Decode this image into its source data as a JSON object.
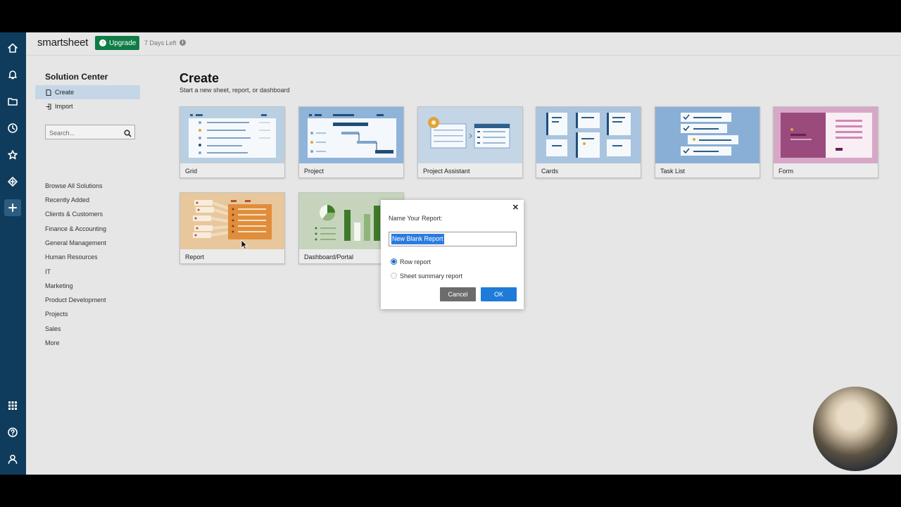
{
  "app": {
    "logo": "smartsheet",
    "upgrade_label": "Upgrade",
    "trial_text": "7 Days Left"
  },
  "leftnav": {
    "top_icons": [
      "home-icon",
      "bell-icon",
      "folder-icon",
      "clock-icon",
      "star-icon",
      "solutions-icon",
      "plus-icon"
    ],
    "bottom_icons": [
      "apps-grid-icon",
      "help-icon",
      "user-icon"
    ]
  },
  "sidebar": {
    "title": "Solution Center",
    "create_label": "Create",
    "import_label": "Import",
    "search_placeholder": "Search...",
    "categories": [
      "Browse All Solutions",
      "Recently Added",
      "Clients & Customers",
      "Finance & Accounting",
      "General Management",
      "Human Resources",
      "IT",
      "Marketing",
      "Product Development",
      "Projects",
      "Sales",
      "More"
    ]
  },
  "main": {
    "title": "Create",
    "subtitle": "Start a new sheet, report, or dashboard",
    "cards": [
      {
        "label": "Grid",
        "color": "#b9cfe2"
      },
      {
        "label": "Project",
        "color": "#8fb3d9"
      },
      {
        "label": "Project Assistant",
        "color": "#c4d5e6"
      },
      {
        "label": "Cards",
        "color": "#a9c4df"
      },
      {
        "label": "Task List",
        "color": "#8aafd6"
      },
      {
        "label": "Form",
        "color": "#d7a7c7"
      },
      {
        "label": "Report",
        "color": "#e8c79c"
      },
      {
        "label": "Dashboard/Portal",
        "color": "#c7d4bd"
      }
    ]
  },
  "dialog": {
    "title": "Name Your Report:",
    "input_value": "New Blank Report",
    "option_row": "Row report",
    "option_summary": "Sheet summary report",
    "cancel_label": "Cancel",
    "ok_label": "OK"
  }
}
